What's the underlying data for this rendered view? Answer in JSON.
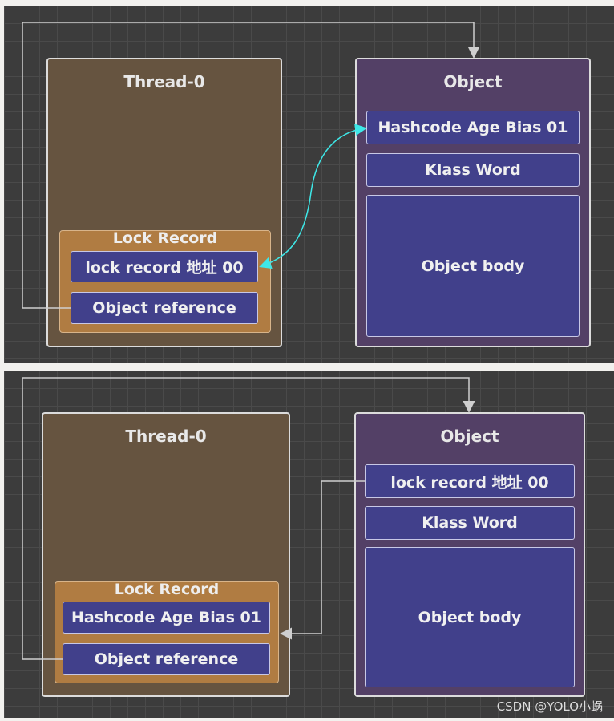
{
  "panels": [
    {
      "thread_title": "Thread-0",
      "object_title": "Object",
      "lock_record_title": "Lock Record",
      "lock_record_cells": [
        "lock  record 地址 00",
        "Object reference"
      ],
      "object_cells": [
        "Hashcode Age Bias 01",
        "Klass Word",
        "Object body"
      ]
    },
    {
      "thread_title": "Thread-0",
      "object_title": "Object",
      "lock_record_title": "Lock Record",
      "lock_record_cells": [
        "Hashcode Age Bias 01",
        "Object reference"
      ],
      "object_cells": [
        "lock  record 地址 00",
        "Klass Word",
        "Object body"
      ]
    }
  ],
  "watermark": "CSDN @YOLO小蜗",
  "colors": {
    "swap_arrow": "#3ee8e8",
    "arrow": "#cfcfcf"
  }
}
